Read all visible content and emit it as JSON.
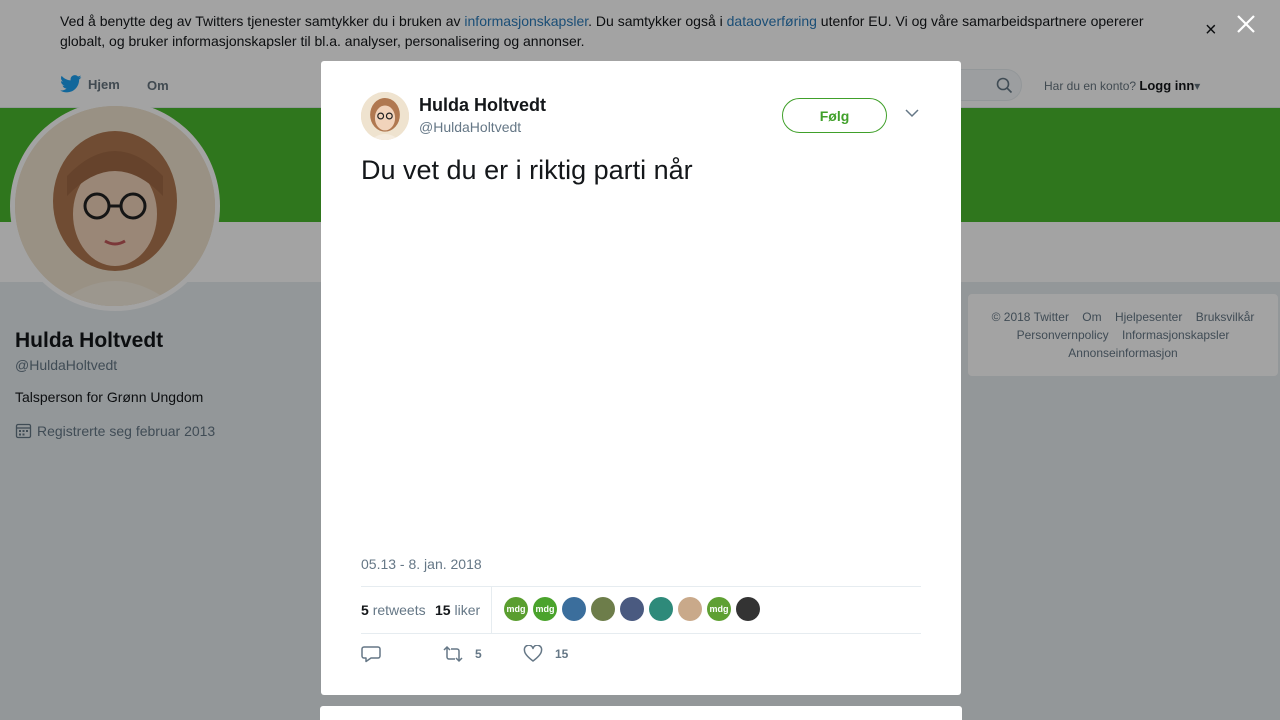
{
  "cookie_banner": {
    "text_1": "Ved å benytte deg av Twitters tjenester samtykker du i bruken av ",
    "link_1": "informasjonskapsler",
    "text_2": ". Du samtykker også i ",
    "link_2": "dataoverføring",
    "text_3": " utenfor EU. Vi og våre samarbeidspartnere opererer globalt, og bruker informasjonskapsler til bl.a. analyser, personalisering og annonser.",
    "close_label": "×"
  },
  "nav": {
    "home": "Hjem",
    "about": "Om",
    "login_prompt": "Har du en konto?",
    "login_link": "Logg inn",
    "login_caret": "▾"
  },
  "profile": {
    "name": "Hulda Holtvedt",
    "handle": "@HuldaHoltvedt",
    "bio": "Talsperson for Grønn Ungdom",
    "joined": "Registrerte seg februar 2013"
  },
  "footer": {
    "links": [
      "© 2018 Twitter",
      "Om",
      "Hjelpesenter",
      "Bruksvilkår",
      "Personvernpolicy",
      "Informasjonskapsler",
      "Annonseinformasjon"
    ]
  },
  "tweet": {
    "author_name": "Hulda Holtvedt",
    "author_handle": "@HuldaHoltvedt",
    "follow_label": "Følg",
    "text": "Du vet du er i riktig parti når",
    "timestamp": "05.13 - 8. jan. 2018",
    "retweets_count": "5",
    "retweets_label": "retweets",
    "likes_count": "15",
    "likes_label": "liker",
    "action_retweet_count": "5",
    "action_like_count": "15",
    "likers": [
      {
        "label": "mdg",
        "color": "#5a9e2f"
      },
      {
        "label": "mdg",
        "color": "#4aa32c"
      },
      {
        "label": "",
        "color": "#3b6e9c"
      },
      {
        "label": "",
        "color": "#6d7d4a"
      },
      {
        "label": "",
        "color": "#4a5a80"
      },
      {
        "label": "",
        "color": "#2e8a7a"
      },
      {
        "label": "",
        "color": "#c9a98a"
      },
      {
        "label": "mdg",
        "color": "#5fa033"
      },
      {
        "label": "",
        "color": "#333333"
      }
    ]
  },
  "colors": {
    "accent": "#40a02a",
    "banner": "#4ab92e",
    "link": "#2b7bb9"
  }
}
